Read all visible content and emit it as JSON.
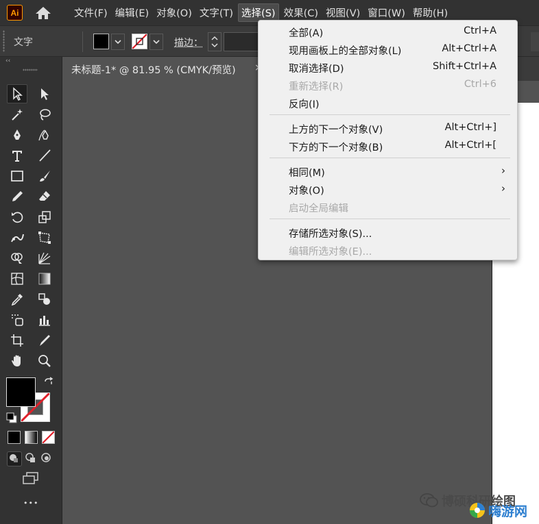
{
  "app": {
    "logo_text": "Ai"
  },
  "menubar": {
    "items": [
      {
        "label": "文件(F)"
      },
      {
        "label": "编辑(E)"
      },
      {
        "label": "对象(O)"
      },
      {
        "label": "文字(T)"
      },
      {
        "label": "选择(S)"
      },
      {
        "label": "效果(C)"
      },
      {
        "label": "视图(V)"
      },
      {
        "label": "窗口(W)"
      },
      {
        "label": "帮助(H)"
      }
    ],
    "active": "选择(S)"
  },
  "controlbar": {
    "context_label": "文字",
    "fill_color": "#000000",
    "stroke_color": "none",
    "stroke_label": "描边："
  },
  "document_tab": {
    "title": "未标题-1* @ 81.95 % (CMYK/预览)",
    "close_glyph": "×"
  },
  "select_menu": {
    "items": [
      {
        "label": "全部(A)",
        "shortcut": "Ctrl+A",
        "enabled": true
      },
      {
        "label": "现用画板上的全部对象(L)",
        "shortcut": "Alt+Ctrl+A",
        "enabled": true
      },
      {
        "label": "取消选择(D)",
        "shortcut": "Shift+Ctrl+A",
        "enabled": true
      },
      {
        "label": "重新选择(R)",
        "shortcut": "Ctrl+6",
        "enabled": false
      },
      {
        "label": "反向(I)",
        "shortcut": "",
        "enabled": true
      },
      {
        "label": "上方的下一个对象(V)",
        "shortcut": "Alt+Ctrl+]",
        "enabled": true
      },
      {
        "label": "下方的下一个对象(B)",
        "shortcut": "Alt+Ctrl+[",
        "enabled": true
      },
      {
        "label": "相同(M)",
        "shortcut": "",
        "submenu": true,
        "enabled": true
      },
      {
        "label": "对象(O)",
        "shortcut": "",
        "submenu": true,
        "enabled": true
      },
      {
        "label": "启动全局编辑",
        "shortcut": "",
        "enabled": false
      },
      {
        "label": "存储所选对象(S)...",
        "shortcut": "",
        "enabled": true
      },
      {
        "label": "编辑所选对象(E)...",
        "shortcut": "",
        "enabled": false
      }
    ],
    "submenu_glyph": "›"
  },
  "toolbar": {
    "collapse_glyph": "‹‹",
    "more_glyph": "•••",
    "tools": [
      "selection-tool-icon",
      "direct-selection-tool-icon",
      "magic-wand-tool-icon",
      "lasso-tool-icon",
      "pen-tool-icon",
      "curvature-tool-icon",
      "type-tool-icon",
      "line-segment-tool-icon",
      "rectangle-tool-icon",
      "paintbrush-tool-icon",
      "pencil-tool-icon",
      "eraser-tool-icon",
      "rotate-tool-icon",
      "scale-tool-icon",
      "puppet-warp-tool-icon",
      "free-transform-tool-icon",
      "shape-builder-tool-icon",
      "perspective-grid-tool-icon",
      "mesh-tool-icon",
      "gradient-tool-icon",
      "eyedropper-tool-icon",
      "blend-tool-icon",
      "symbol-sprayer-tool-icon",
      "column-graph-tool-icon",
      "artboard-tool-icon",
      "slice-tool-icon",
      "hand-tool-icon",
      "zoom-tool-icon"
    ]
  },
  "watermark": {
    "text": "博硕科研绘图",
    "brand": "嗨游网"
  },
  "colors": {
    "menubar_bg": "#323232",
    "canvas_bg": "#535353",
    "dropdown_bg": "#f0f0f0",
    "logo_orange": "#ff9a00",
    "none_red": "#e0202a",
    "brand_blue": "#2d7fd0"
  }
}
